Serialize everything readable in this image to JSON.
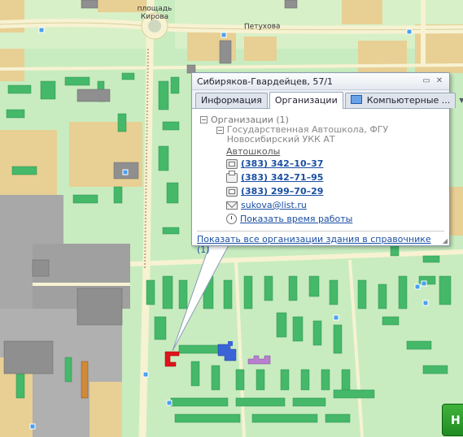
{
  "map": {
    "square_label": "площадь\nКирова",
    "street_label": "Петухова"
  },
  "popup": {
    "title": "Сибиряков-Гвардейцев, 57/1",
    "tabs": [
      {
        "label": "Информация"
      },
      {
        "label": "Организации",
        "active": true
      },
      {
        "label": "Компьютерные ..."
      }
    ],
    "organizations_header": "Организации (1)",
    "org_name": "Государственная Автошкола, ФГУ Новосибирский УКК АТ",
    "category": "Автошколы",
    "phones": [
      {
        "number": "(383) 342–10–37",
        "icon": "phone-icon"
      },
      {
        "number": "(383) 342–71–95",
        "icon": "fax-icon"
      },
      {
        "number": "(383) 299–70–29",
        "icon": "phone-icon"
      }
    ],
    "email": "sukova@list.ru",
    "hours_link": "Показать время работы",
    "footer_link": "Показать все организации здания в справочнике",
    "footer_count": "(1)"
  },
  "green_button": "Н",
  "colors": {
    "map_bg": "#c8ecc0",
    "building_green": "#45b86a",
    "building_tan": "#e8cf94",
    "road": "#f7f2d2",
    "highlight_red": "#e0141c",
    "highlight_blue": "#3b63d8",
    "highlight_purple": "#b87fd0",
    "industrial_gray": "#9a9a9a"
  }
}
